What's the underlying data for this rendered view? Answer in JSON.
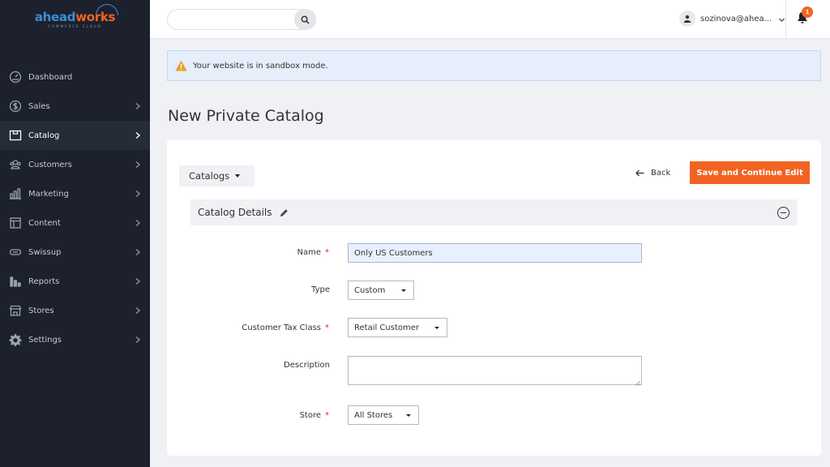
{
  "brand": {
    "logo_part1": "ahead",
    "logo_part2": "works",
    "logo_sub": "COMMERCE CLOUD",
    "accent_color": "#f26322",
    "brand_blue": "#3c8ed6"
  },
  "sidebar": {
    "items": [
      {
        "label": "Dashboard",
        "icon": "dashboard-icon",
        "has_submenu": false
      },
      {
        "label": "Sales",
        "icon": "dollar-icon",
        "has_submenu": true
      },
      {
        "label": "Catalog",
        "icon": "catalog-icon",
        "has_submenu": true,
        "active": true
      },
      {
        "label": "Customers",
        "icon": "customers-icon",
        "has_submenu": true
      },
      {
        "label": "Marketing",
        "icon": "marketing-icon",
        "has_submenu": true
      },
      {
        "label": "Content",
        "icon": "content-icon",
        "has_submenu": true
      },
      {
        "label": "Swissup",
        "icon": "swissup-icon",
        "has_submenu": true
      },
      {
        "label": "Reports",
        "icon": "reports-icon",
        "has_submenu": true
      },
      {
        "label": "Stores",
        "icon": "stores-icon",
        "has_submenu": true
      },
      {
        "label": "Settings",
        "icon": "gear-icon",
        "has_submenu": true
      }
    ]
  },
  "header": {
    "search_value": "",
    "user_name": "sozinova@ahea...",
    "notification_count": "1"
  },
  "notice": {
    "text": "Your website is in sandbox mode."
  },
  "page": {
    "title": "New Private Catalog"
  },
  "toolbar": {
    "catalogs_label": "Catalogs",
    "back_label": "Back",
    "save_label": "Save and Continue Edit"
  },
  "section": {
    "title": "Catalog Details"
  },
  "form": {
    "name": {
      "label": "Name",
      "value": "Only US Customers",
      "required": true
    },
    "type": {
      "label": "Type",
      "value": "Custom",
      "required": false
    },
    "tax_class": {
      "label": "Customer Tax Class",
      "value": "Retail Customer",
      "required": true
    },
    "description": {
      "label": "Description",
      "value": "",
      "required": false
    },
    "store": {
      "label": "Store",
      "value": "All Stores",
      "required": true
    }
  }
}
